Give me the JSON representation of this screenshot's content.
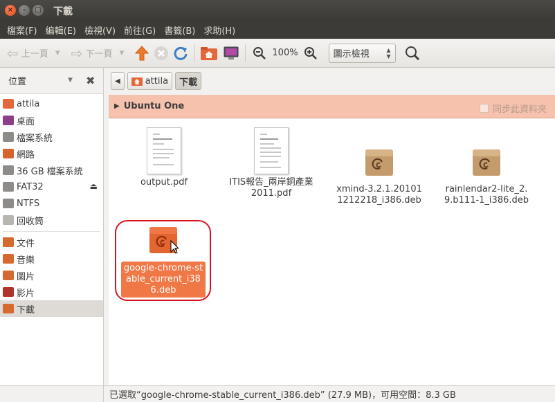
{
  "window": {
    "title": "下載"
  },
  "menu": [
    "檔案(F)",
    "編輯(E)",
    "檢視(V)",
    "前往(G)",
    "書籤(B)",
    "求助(H)"
  ],
  "toolbar": {
    "back_label": "上一頁",
    "forward_label": "下一頁",
    "zoom_level": "100%",
    "view_mode": "圖示檢視"
  },
  "sidebar": {
    "header": "位置",
    "places": [
      {
        "label": "attila",
        "icon": "home-folder-icon"
      },
      {
        "label": "桌面",
        "icon": "desktop-icon"
      },
      {
        "label": "檔案系統",
        "icon": "drive-icon"
      },
      {
        "label": "網路",
        "icon": "network-icon"
      },
      {
        "label": "36 GB 檔案系統",
        "icon": "drive-icon"
      },
      {
        "label": "FAT32",
        "icon": "drive-icon",
        "eject": true
      },
      {
        "label": "NTFS",
        "icon": "drive-icon"
      },
      {
        "label": "回收筒",
        "icon": "trash-icon"
      }
    ],
    "bookmarks": [
      {
        "label": "文件",
        "icon": "documents-folder-icon"
      },
      {
        "label": "音樂",
        "icon": "music-folder-icon"
      },
      {
        "label": "圖片",
        "icon": "pictures-folder-icon"
      },
      {
        "label": "影片",
        "icon": "videos-folder-icon"
      },
      {
        "label": "下載",
        "icon": "downloads-folder-icon",
        "active": true
      }
    ]
  },
  "pathbar": {
    "home": "attila",
    "current": "下載"
  },
  "ubuntu_one": {
    "title": "Ubuntu One",
    "sync_label": "同步此資料夾"
  },
  "files": [
    {
      "name": "output.pdf",
      "type": "pdf"
    },
    {
      "name": "ITIS報告_兩岸銅產業2011.pdf",
      "type": "pdf"
    },
    {
      "name": "xmind-3.2.1.201011212218_i386.deb",
      "type": "deb"
    },
    {
      "name": "rainlendar2-lite_2.9.b111-1_i386.deb",
      "type": "deb"
    },
    {
      "name": "google-chrome-stable_current_i386.deb",
      "type": "deb",
      "selected": true
    }
  ],
  "status": "已選取“google-chrome-stable_current_i386.deb” (27.9 MB)，可用空間：8.3 GB",
  "colors": {
    "accent": "#f07746",
    "highlight_ring": "#d8131f",
    "ubuntu_one_bar": "#f6c1ad",
    "titlebar": "#3c3b37"
  }
}
